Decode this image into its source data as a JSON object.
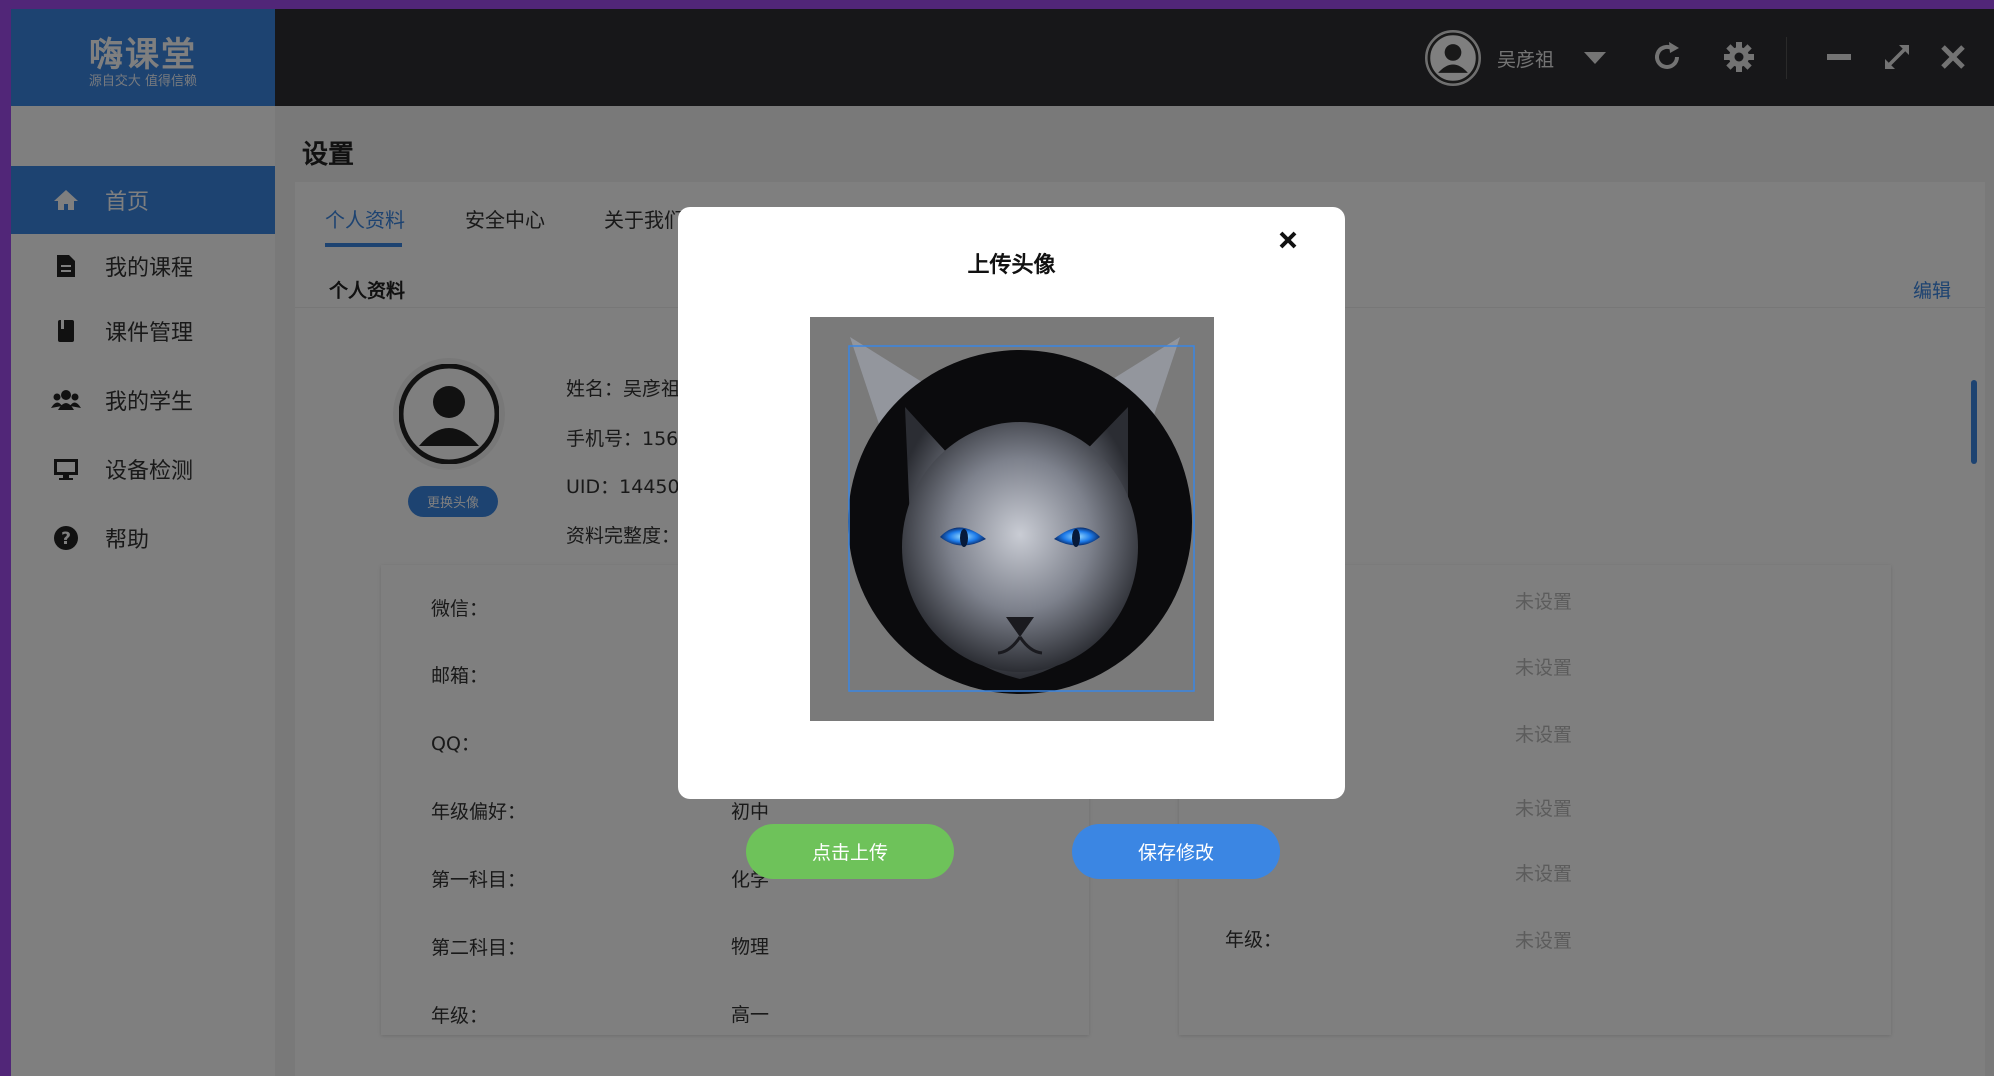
{
  "app": {
    "logo_title": "嗨课堂",
    "logo_subtitle": "源自交大 值得信赖",
    "accent_color": "#3b86e3",
    "topbar_color": "#2f2f33"
  },
  "topbar": {
    "user_name": "吴彦祖",
    "icons": [
      "user-avatar-icon",
      "caret-down-icon",
      "refresh-icon",
      "gear-icon",
      "minimize-icon",
      "maximize-icon",
      "close-icon"
    ]
  },
  "sidebar": {
    "items": [
      {
        "label": "首页",
        "icon": "home-icon",
        "active": true
      },
      {
        "label": "我的课程",
        "icon": "file-icon",
        "active": false
      },
      {
        "label": "课件管理",
        "icon": "book-icon",
        "active": false
      },
      {
        "label": "我的学生",
        "icon": "users-icon",
        "active": false
      },
      {
        "label": "设备检测",
        "icon": "monitor-icon",
        "active": false
      },
      {
        "label": "帮助",
        "icon": "help-icon",
        "active": false
      }
    ]
  },
  "main": {
    "page_title": "设置",
    "tabs": [
      {
        "label": "个人资料",
        "active": true
      },
      {
        "label": "安全中心",
        "active": false
      },
      {
        "label": "关于我们",
        "active": false
      }
    ],
    "section_title": "个人资料",
    "edit_label": "编辑",
    "change_avatar_label": "更换头像",
    "profile": {
      "name_line": "姓名：吴彦祖",
      "phone_line": "手机号：156",
      "uid_line": "UID：14450",
      "completeness_line": "资料完整度："
    },
    "left_card": [
      {
        "label": "微信：",
        "value": ""
      },
      {
        "label": "邮箱：",
        "value": ""
      },
      {
        "label": "QQ：",
        "value": ""
      },
      {
        "label": "年级偏好：",
        "value": "初中"
      },
      {
        "label": "第一科目：",
        "value": "化学"
      },
      {
        "label": "第二科目：",
        "value": "物理"
      },
      {
        "label": "年级：",
        "value": "高一"
      }
    ],
    "right_card": {
      "unset_text": "未设置",
      "grade_label": "年级："
    }
  },
  "modal": {
    "title": "上传头像",
    "upload_button": "点击上传",
    "save_button": "保存修改",
    "upload_color": "#6ec25a"
  }
}
